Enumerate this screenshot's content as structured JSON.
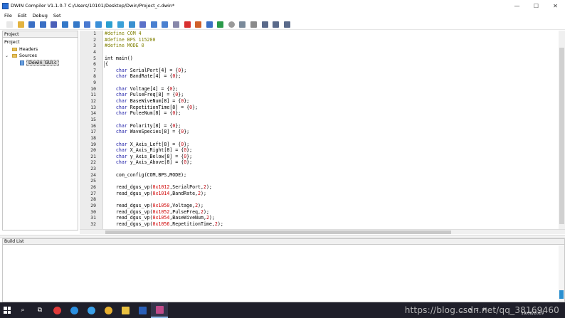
{
  "window": {
    "title": "DWIN Compiler V1.1.0.7    C:/Users/10101/Desktop/Dwin/Project_c.dwin*",
    "controls": {
      "minimize": "—",
      "maximize": "☐",
      "close": "✕"
    }
  },
  "menu": [
    "File",
    "Edit",
    "Debug",
    "Set"
  ],
  "toolbar": {
    "icons": [
      {
        "name": "new-file-icon",
        "color": "#e8e8e8"
      },
      {
        "name": "open-folder-icon",
        "color": "#e3b340"
      },
      {
        "name": "save-icon",
        "color": "#3a6fc4"
      },
      {
        "name": "save-all-icon",
        "color": "#3a6fc4"
      },
      {
        "name": "close-file-icon",
        "color": "#4a5fb8"
      },
      {
        "name": "undo-icon",
        "color": "#3478c8"
      },
      {
        "name": "redo-icon",
        "color": "#3478c8"
      },
      {
        "name": "cut-icon",
        "color": "#4a7ad0"
      },
      {
        "name": "copy-icon",
        "color": "#3a8fd8"
      },
      {
        "name": "paste-icon",
        "color": "#2a9fd0"
      },
      {
        "name": "find-icon",
        "color": "#3aa0d8"
      },
      {
        "name": "find-next-icon",
        "color": "#3a90d0"
      },
      {
        "name": "replace-icon",
        "color": "#5a70c8"
      },
      {
        "name": "indent-icon",
        "color": "#4a80d0"
      },
      {
        "name": "outdent-icon",
        "color": "#4a80d0"
      },
      {
        "name": "comment-icon",
        "color": "#8888aa"
      },
      {
        "name": "breakpoint-icon",
        "color": "#d83030"
      },
      {
        "name": "build-icon",
        "color": "#d0602a"
      },
      {
        "name": "rebuild-icon",
        "color": "#3a6fc4"
      },
      {
        "name": "run-icon",
        "color": "#2a9a4a"
      },
      {
        "name": "debug-icon",
        "color": "#6a6a6a"
      },
      {
        "name": "step-icon",
        "color": "#7a8a9a"
      },
      {
        "name": "stop-icon",
        "color": "#8a8a8a"
      },
      {
        "name": "step-into-icon",
        "color": "#5a6a8a"
      },
      {
        "name": "step-over-icon",
        "color": "#5a6a8a"
      },
      {
        "name": "step-out-icon",
        "color": "#5a6a8a"
      }
    ]
  },
  "project_panel": {
    "header": "Project",
    "tree": [
      {
        "label": "Project",
        "level": 0,
        "kind": "root"
      },
      {
        "label": "Headers",
        "level": 1,
        "kind": "folder"
      },
      {
        "label": "Sources",
        "level": 1,
        "kind": "folder",
        "expanded": true
      },
      {
        "label": "Dewin_GUI.c",
        "level": 2,
        "kind": "file",
        "selected": true
      }
    ]
  },
  "editor": {
    "lines": [
      [
        [
          "pp",
          "#define COM 4"
        ]
      ],
      [
        [
          "pp",
          "#define BPS 115200"
        ]
      ],
      [
        [
          "pp",
          "#define MODE 0"
        ]
      ],
      [],
      [
        [
          "plain",
          "int main()"
        ]
      ],
      [
        [
          "plain",
          "{"
        ]
      ],
      [
        [
          "plain",
          "    "
        ],
        [
          "kw",
          "char"
        ],
        [
          "plain",
          " SerialPort[4] = {"
        ],
        [
          "num",
          "0"
        ],
        [
          "plain",
          "};"
        ]
      ],
      [
        [
          "plain",
          "    "
        ],
        [
          "kw",
          "char"
        ],
        [
          "plain",
          " BandRate[4] = {"
        ],
        [
          "num",
          "0"
        ],
        [
          "plain",
          "};"
        ]
      ],
      [],
      [
        [
          "plain",
          "    "
        ],
        [
          "kw",
          "char"
        ],
        [
          "plain",
          " Voltage[4] = {"
        ],
        [
          "num",
          "0"
        ],
        [
          "plain",
          "};"
        ]
      ],
      [
        [
          "plain",
          "    "
        ],
        [
          "kw",
          "char"
        ],
        [
          "plain",
          " PulseFreq[8] = {"
        ],
        [
          "num",
          "0"
        ],
        [
          "plain",
          "};"
        ]
      ],
      [
        [
          "plain",
          "    "
        ],
        [
          "kw",
          "char"
        ],
        [
          "plain",
          " BaseWiveNum[8] = {"
        ],
        [
          "num",
          "0"
        ],
        [
          "plain",
          "};"
        ]
      ],
      [
        [
          "plain",
          "    "
        ],
        [
          "kw",
          "char"
        ],
        [
          "plain",
          " RepetitionTime[8] = {"
        ],
        [
          "num",
          "0"
        ],
        [
          "plain",
          "};"
        ]
      ],
      [
        [
          "plain",
          "    "
        ],
        [
          "kw",
          "char"
        ],
        [
          "plain",
          " PuleeNum[8] = {"
        ],
        [
          "num",
          "0"
        ],
        [
          "plain",
          "};"
        ]
      ],
      [],
      [
        [
          "plain",
          "    "
        ],
        [
          "kw",
          "char"
        ],
        [
          "plain",
          " Polarity[8] = {"
        ],
        [
          "num",
          "0"
        ],
        [
          "plain",
          "};"
        ]
      ],
      [
        [
          "plain",
          "    "
        ],
        [
          "kw",
          "char"
        ],
        [
          "plain",
          " WaveSpecies[8] = {"
        ],
        [
          "num",
          "0"
        ],
        [
          "plain",
          "};"
        ]
      ],
      [],
      [
        [
          "plain",
          "    "
        ],
        [
          "kw",
          "char"
        ],
        [
          "plain",
          " X_Axis_Left[8] = {"
        ],
        [
          "num",
          "0"
        ],
        [
          "plain",
          "};"
        ]
      ],
      [
        [
          "plain",
          "    "
        ],
        [
          "kw",
          "char"
        ],
        [
          "plain",
          " X_Axis_Right[8] = {"
        ],
        [
          "num",
          "0"
        ],
        [
          "plain",
          "};"
        ]
      ],
      [
        [
          "plain",
          "    "
        ],
        [
          "kw",
          "char"
        ],
        [
          "plain",
          " y_Axis_Below[8] = {"
        ],
        [
          "num",
          "0"
        ],
        [
          "plain",
          "};"
        ]
      ],
      [
        [
          "plain",
          "    "
        ],
        [
          "kw",
          "char"
        ],
        [
          "plain",
          " y_Axis_Above[8] = {"
        ],
        [
          "num",
          "0"
        ],
        [
          "plain",
          "};"
        ]
      ],
      [],
      [
        [
          "plain",
          "    com_config(COM,BPS,MODE);"
        ]
      ],
      [],
      [
        [
          "plain",
          "    read_dgus_vp("
        ],
        [
          "hex",
          "0x1012"
        ],
        [
          "plain",
          ",SerialPort,"
        ],
        [
          "num",
          "2"
        ],
        [
          "plain",
          ");"
        ]
      ],
      [
        [
          "plain",
          "    read_dgus_vp("
        ],
        [
          "hex",
          "0x1014"
        ],
        [
          "plain",
          ",BandRate,"
        ],
        [
          "num",
          "2"
        ],
        [
          "plain",
          ");"
        ]
      ],
      [],
      [
        [
          "plain",
          "    read_dgus_vp("
        ],
        [
          "hex",
          "0x1050"
        ],
        [
          "plain",
          ",Voltage,"
        ],
        [
          "num",
          "2"
        ],
        [
          "plain",
          ");"
        ]
      ],
      [
        [
          "plain",
          "    read_dgus_vp("
        ],
        [
          "hex",
          "0x1052"
        ],
        [
          "plain",
          ",PulseFreq,"
        ],
        [
          "num",
          "2"
        ],
        [
          "plain",
          ");"
        ]
      ],
      [
        [
          "plain",
          "    read_dgus_vp("
        ],
        [
          "hex",
          "0x1054"
        ],
        [
          "plain",
          ",BaseWiveNum,"
        ],
        [
          "num",
          "2"
        ],
        [
          "plain",
          ");"
        ]
      ],
      [
        [
          "plain",
          "    read_dgus_vp("
        ],
        [
          "hex",
          "0x1056"
        ],
        [
          "plain",
          ",RepetitionTime,"
        ],
        [
          "num",
          "2"
        ],
        [
          "plain",
          ");"
        ]
      ]
    ]
  },
  "build_panel": {
    "header": "Build List"
  },
  "taskbar": {
    "apps": [
      {
        "name": "search-icon",
        "glyph": "⌕",
        "color": "#ffffff"
      },
      {
        "name": "task-view-icon",
        "glyph": "⧉",
        "color": "#ffffff"
      },
      {
        "name": "netease-music-icon",
        "glyph": "",
        "color": "#e03a3a"
      },
      {
        "name": "edge-icon",
        "glyph": "",
        "color": "#2b8fe0"
      },
      {
        "name": "k-app-icon",
        "glyph": "",
        "color": "#3aa0e8"
      },
      {
        "name": "chrome-icon",
        "glyph": "",
        "color": "#e8b030"
      },
      {
        "name": "file-explorer-icon",
        "glyph": "",
        "color": "#e8c040"
      },
      {
        "name": "word-icon",
        "glyph": "",
        "color": "#2a5fb8"
      },
      {
        "name": "dwin-compiler-icon",
        "glyph": "",
        "color": "#c04a8a"
      }
    ],
    "watermark": "https://blog.csdn.net/qq_38169460",
    "date": "19/08/2019",
    "tray_letter": "M"
  }
}
